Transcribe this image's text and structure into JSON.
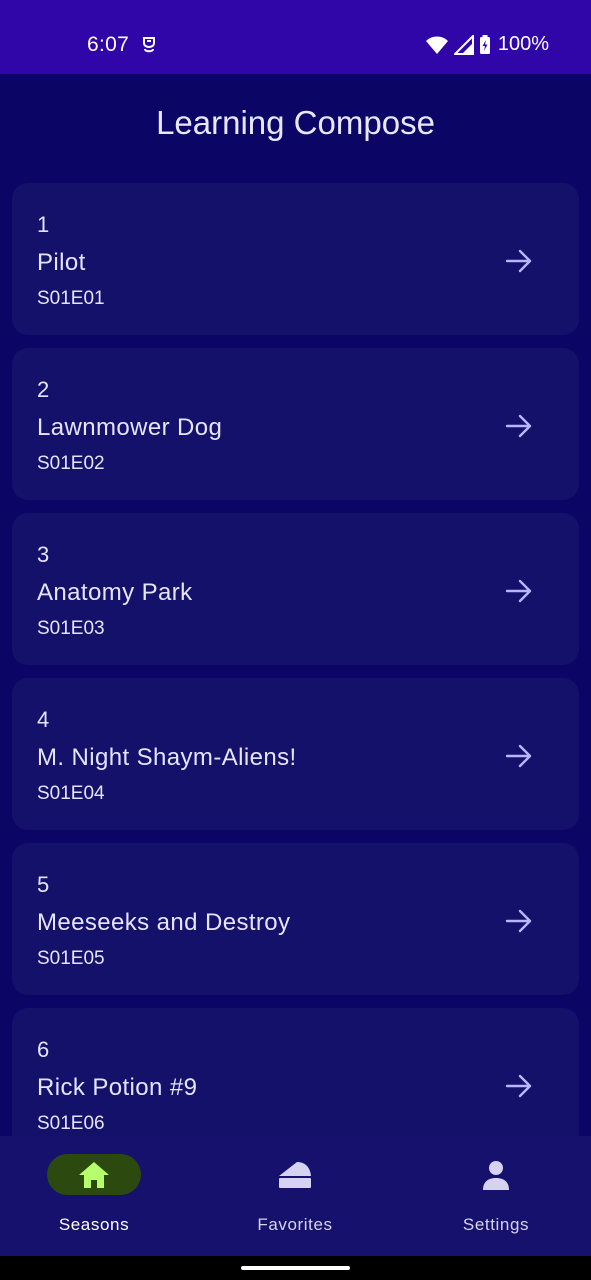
{
  "status_bar": {
    "time": "6:07",
    "battery": "100%"
  },
  "app": {
    "title": "Learning Compose"
  },
  "episodes": [
    {
      "number": "1",
      "title": "Pilot",
      "code": "S01E01"
    },
    {
      "number": "2",
      "title": "Lawnmower Dog",
      "code": "S01E02"
    },
    {
      "number": "3",
      "title": "Anatomy Park",
      "code": "S01E03"
    },
    {
      "number": "4",
      "title": "M. Night Shaym-Aliens!",
      "code": "S01E04"
    },
    {
      "number": "5",
      "title": "Meeseeks and Destroy",
      "code": "S01E05"
    },
    {
      "number": "6",
      "title": "Rick Potion #9",
      "code": "S01E06"
    }
  ],
  "bottom_nav": {
    "items": [
      {
        "label": "Seasons",
        "icon": "home-icon",
        "active": true
      },
      {
        "label": "Favorites",
        "icon": "favorites-icon",
        "active": false
      },
      {
        "label": "Settings",
        "icon": "person-icon",
        "active": false
      }
    ]
  },
  "colors": {
    "status_bar": "#3006a8",
    "background": "#0b0566",
    "card": "#13116a",
    "nav_bar": "#16116c",
    "active_pill": "#2c4a10",
    "active_icon": "#b6ff6a",
    "arrow": "#b9b6ff"
  }
}
